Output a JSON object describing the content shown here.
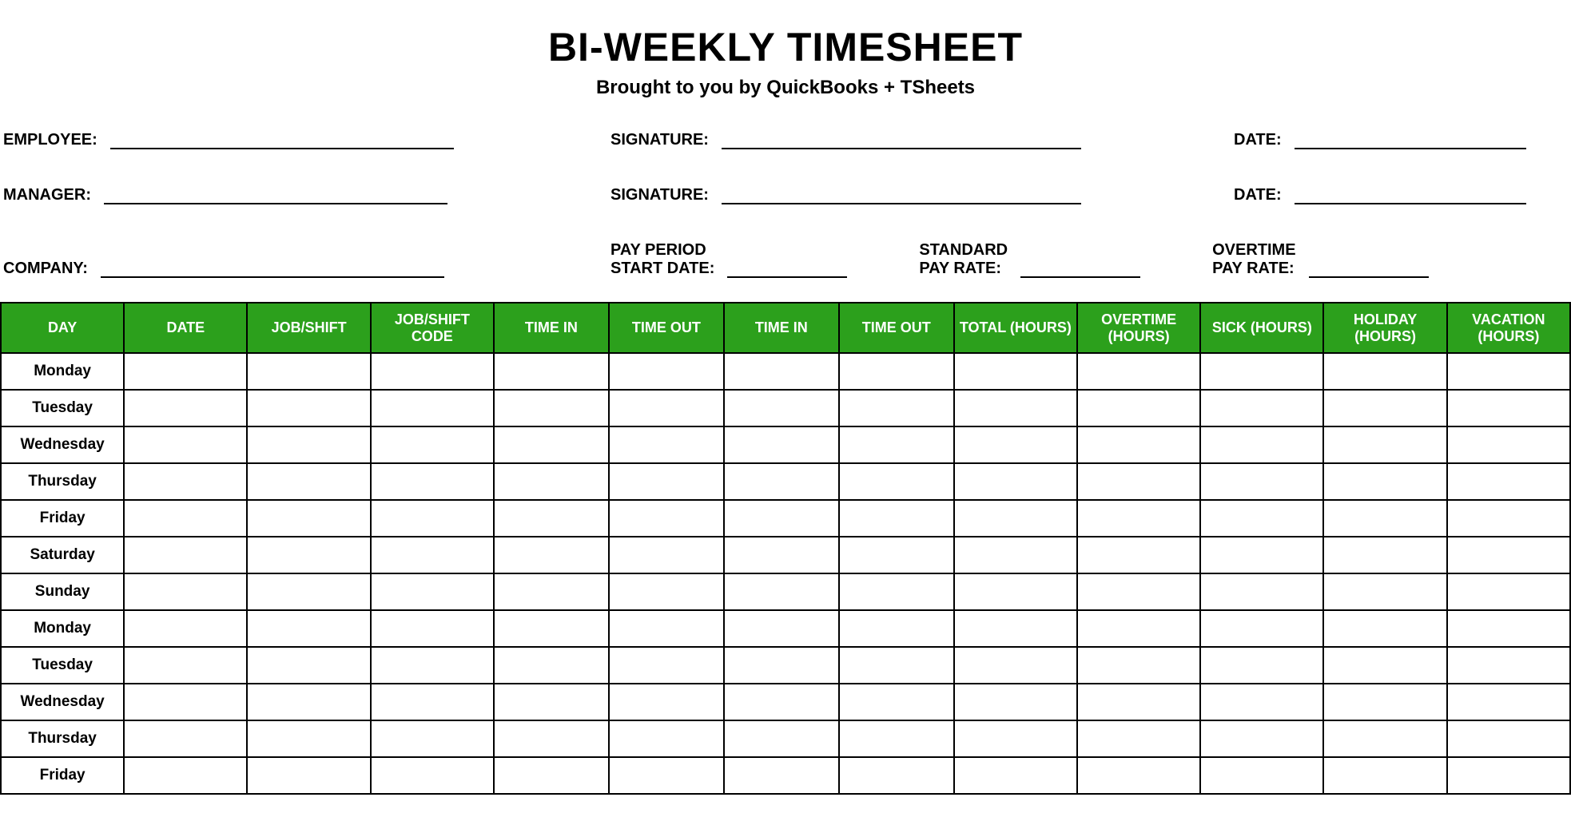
{
  "header": {
    "title": "BI-WEEKLY TIMESHEET",
    "subtitle": "Brought to you by QuickBooks + TSheets"
  },
  "meta": {
    "employee_label": "EMPLOYEE:",
    "employee_value": "",
    "employee_sig_label": "SIGNATURE:",
    "employee_sig_value": "",
    "employee_date_label": "DATE:",
    "employee_date_value": "",
    "manager_label": "MANAGER:",
    "manager_value": "",
    "manager_sig_label": "SIGNATURE:",
    "manager_sig_value": "",
    "manager_date_label": "DATE:",
    "manager_date_value": "",
    "company_label": "COMPANY:",
    "company_value": "",
    "pay_period_label": "PAY PERIOD\nSTART DATE:",
    "pay_period_value": "",
    "std_rate_label": "STANDARD\nPAY RATE:",
    "std_rate_value": "",
    "ot_rate_label": "OVERTIME\nPAY RATE:",
    "ot_rate_value": ""
  },
  "table": {
    "columns": [
      "DAY",
      "DATE",
      "JOB/SHIFT",
      "JOB/SHIFT CODE",
      "TIME IN",
      "TIME OUT",
      "TIME IN",
      "TIME OUT",
      "TOTAL (HOURS)",
      "OVERTIME (HOURS)",
      "SICK (HOURS)",
      "HOLIDAY (HOURS)",
      "VACATION (HOURS)"
    ],
    "rows": [
      {
        "day": "Monday",
        "date": "",
        "job": "",
        "code": "",
        "in1": "",
        "out1": "",
        "in2": "",
        "out2": "",
        "total": "",
        "ot": "",
        "sick": "",
        "holiday": "",
        "vacation": ""
      },
      {
        "day": "Tuesday",
        "date": "",
        "job": "",
        "code": "",
        "in1": "",
        "out1": "",
        "in2": "",
        "out2": "",
        "total": "",
        "ot": "",
        "sick": "",
        "holiday": "",
        "vacation": ""
      },
      {
        "day": "Wednesday",
        "date": "",
        "job": "",
        "code": "",
        "in1": "",
        "out1": "",
        "in2": "",
        "out2": "",
        "total": "",
        "ot": "",
        "sick": "",
        "holiday": "",
        "vacation": ""
      },
      {
        "day": "Thursday",
        "date": "",
        "job": "",
        "code": "",
        "in1": "",
        "out1": "",
        "in2": "",
        "out2": "",
        "total": "",
        "ot": "",
        "sick": "",
        "holiday": "",
        "vacation": ""
      },
      {
        "day": "Friday",
        "date": "",
        "job": "",
        "code": "",
        "in1": "",
        "out1": "",
        "in2": "",
        "out2": "",
        "total": "",
        "ot": "",
        "sick": "",
        "holiday": "",
        "vacation": ""
      },
      {
        "day": "Saturday",
        "date": "",
        "job": "",
        "code": "",
        "in1": "",
        "out1": "",
        "in2": "",
        "out2": "",
        "total": "",
        "ot": "",
        "sick": "",
        "holiday": "",
        "vacation": ""
      },
      {
        "day": "Sunday",
        "date": "",
        "job": "",
        "code": "",
        "in1": "",
        "out1": "",
        "in2": "",
        "out2": "",
        "total": "",
        "ot": "",
        "sick": "",
        "holiday": "",
        "vacation": ""
      },
      {
        "day": "Monday",
        "date": "",
        "job": "",
        "code": "",
        "in1": "",
        "out1": "",
        "in2": "",
        "out2": "",
        "total": "",
        "ot": "",
        "sick": "",
        "holiday": "",
        "vacation": ""
      },
      {
        "day": "Tuesday",
        "date": "",
        "job": "",
        "code": "",
        "in1": "",
        "out1": "",
        "in2": "",
        "out2": "",
        "total": "",
        "ot": "",
        "sick": "",
        "holiday": "",
        "vacation": ""
      },
      {
        "day": "Wednesday",
        "date": "",
        "job": "",
        "code": "",
        "in1": "",
        "out1": "",
        "in2": "",
        "out2": "",
        "total": "",
        "ot": "",
        "sick": "",
        "holiday": "",
        "vacation": ""
      },
      {
        "day": "Thursday",
        "date": "",
        "job": "",
        "code": "",
        "in1": "",
        "out1": "",
        "in2": "",
        "out2": "",
        "total": "",
        "ot": "",
        "sick": "",
        "holiday": "",
        "vacation": ""
      },
      {
        "day": "Friday",
        "date": "",
        "job": "",
        "code": "",
        "in1": "",
        "out1": "",
        "in2": "",
        "out2": "",
        "total": "",
        "ot": "",
        "sick": "",
        "holiday": "",
        "vacation": ""
      }
    ]
  }
}
